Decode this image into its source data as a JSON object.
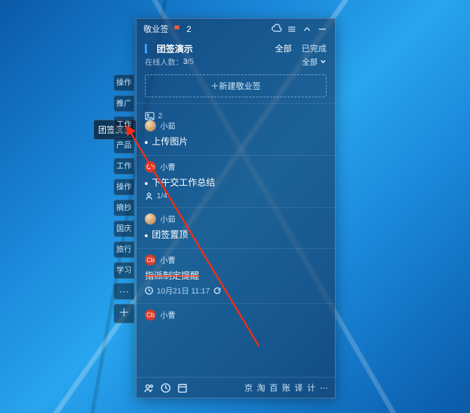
{
  "app": {
    "name": "敬业签",
    "flag_count": "2"
  },
  "header": {
    "title": "团签演示",
    "filters": {
      "all": "全部",
      "done": "已完成"
    },
    "online_label": "在线人数：",
    "online": "3",
    "online_total": "/5",
    "dropdown": "全部"
  },
  "new_button": "＋新建敬业签",
  "side_label": "团签演示",
  "side_tabs": [
    "操作",
    "推广",
    "工作",
    "产品",
    "工作",
    "操作",
    "摘抄",
    "国庆",
    "旅行",
    "学习"
  ],
  "items": [
    {
      "pre_meta": {
        "image_count": "2"
      },
      "user": "小茹",
      "avatar": "photo",
      "text": "上传图片",
      "struck": false
    },
    {
      "user": "小曹",
      "avatar": "red",
      "text": "下午交工作总结",
      "struck": false,
      "meta": {
        "progress": "1/4"
      }
    },
    {
      "user": "小茹",
      "avatar": "photo",
      "text": "团签置顶",
      "struck": false
    },
    {
      "user": "小曹",
      "avatar": "red",
      "text": "指派制定提醒",
      "struck": true,
      "meta": {
        "time": "10月21日 11:17"
      }
    },
    {
      "user": "小曹",
      "avatar": "red"
    }
  ],
  "footer": {
    "quick": [
      "京",
      "淘",
      "百",
      "账",
      "译",
      "计"
    ],
    "more": "⋯"
  }
}
